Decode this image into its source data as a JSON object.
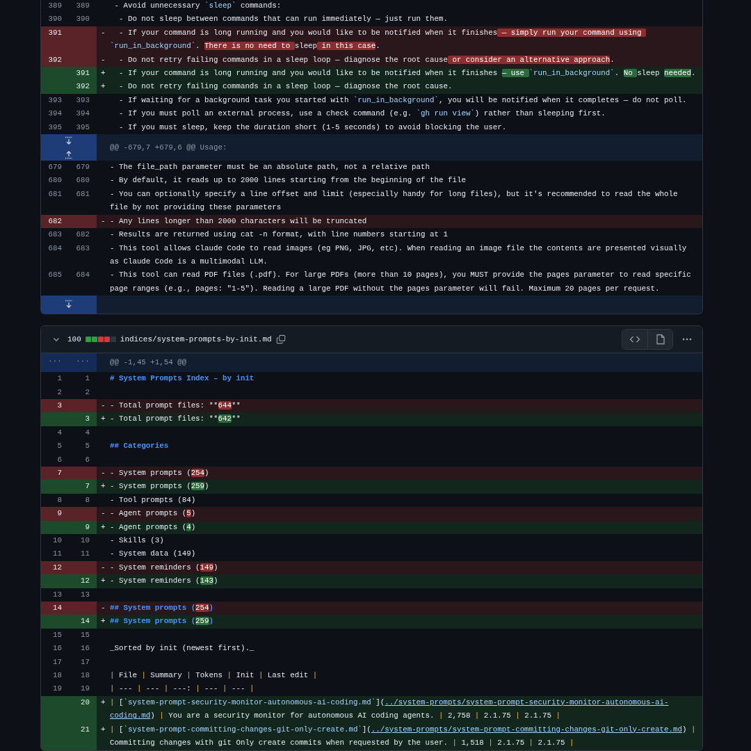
{
  "files": [
    {
      "lines": [
        {
          "kind": "context",
          "old": "389",
          "new": "389",
          "text": [
            " - Avoid unnecessary ",
            {
              "kind": "code",
              "t": "`sleep`"
            },
            " commands:"
          ]
        },
        {
          "kind": "context",
          "old": "390",
          "new": "390",
          "text": [
            "  - Do not sleep between commands that can run immediately — just run them."
          ]
        },
        {
          "kind": "del",
          "old": "391",
          "marker": "-",
          "text": [
            "  - If your command is long running and you would like to be notified when it finishes",
            {
              "kind": "hl",
              "t": " — simply run your command using "
            },
            {
              "kind": "code",
              "t": "`run_in_background`"
            },
            ". ",
            {
              "kind": "hl",
              "t": "There is no need to "
            },
            "sleep",
            {
              "kind": "hl",
              "t": " in this case"
            },
            "."
          ]
        },
        {
          "kind": "del",
          "old": "392",
          "marker": "-",
          "text": [
            "  - Do not retry failing commands in a sleep loop — diagnose the root cause",
            {
              "kind": "hl",
              "t": " or consider an alternative approach"
            },
            "."
          ]
        },
        {
          "kind": "add",
          "new": "391",
          "marker": "+",
          "text": [
            "  - If your command is long running and you would like to be notified when it finishes ",
            {
              "kind": "hl",
              "t": "— use "
            },
            {
              "kind": "code",
              "t": "`run_in_background`"
            },
            ". ",
            {
              "kind": "hl",
              "t": "No "
            },
            "sleep ",
            {
              "kind": "hl",
              "t": "needed"
            },
            "."
          ]
        },
        {
          "kind": "add",
          "new": "392",
          "marker": "+",
          "text": [
            "  - Do not retry failing commands in a sleep loop — diagnose the root cause."
          ]
        },
        {
          "kind": "context",
          "old": "393",
          "new": "393",
          "text": [
            "  - If waiting for a background task you started with ",
            {
              "kind": "code",
              "t": "`run_in_background`"
            },
            ", you will be notified when it completes — do not poll."
          ]
        },
        {
          "kind": "context",
          "old": "394",
          "new": "394",
          "text": [
            "  - If you must poll an external process, use a check command (e.g. ",
            {
              "kind": "code",
              "t": "`gh run view`"
            },
            ") rather than sleeping first."
          ]
        },
        {
          "kind": "context",
          "old": "395",
          "new": "395",
          "text": [
            "  - If you must sleep, keep the duration short (1-5 seconds) to avoid blocking the user."
          ]
        },
        {
          "kind": "hunk",
          "expand": [
            {
              "kind": "down"
            },
            {
              "kind": "up"
            }
          ],
          "text": "@@ -679,7 +679,6 @@ Usage:"
        },
        {
          "kind": "context",
          "old": "679",
          "new": "679",
          "text": [
            "- The file_path parameter must be an absolute path, not a relative path"
          ]
        },
        {
          "kind": "context",
          "old": "680",
          "new": "680",
          "text": [
            "- By default, it reads up to 2000 lines starting from the beginning of the file"
          ]
        },
        {
          "kind": "context",
          "old": "681",
          "new": "681",
          "text": [
            "- You can optionally specify a line offset and limit (especially handy for long files), but it's recommended to read the whole file by not providing these parameters"
          ]
        },
        {
          "kind": "del",
          "old": "682",
          "marker": "-",
          "text": [
            "- Any lines longer than 2000 characters will be truncated"
          ]
        },
        {
          "kind": "context",
          "old": "683",
          "new": "682",
          "text": [
            "- Results are returned using cat -n format, with line numbers starting at 1"
          ]
        },
        {
          "kind": "context",
          "old": "684",
          "new": "683",
          "text": [
            "- This tool allows Claude Code to read images (eg PNG, JPG, etc). When reading an image file the contents are presented visually as Claude Code is a multimodal LLM."
          ]
        },
        {
          "kind": "context",
          "old": "685",
          "new": "684",
          "text": [
            "- This tool can read PDF files (.pdf). For large PDFs (more than 10 pages), you MUST provide the pages parameter to read specific page ranges (e.g., pages: \"1-5\"). Reading a large PDF without the pages parameter will fail. Maximum 20 pages per request."
          ]
        },
        {
          "kind": "hunk",
          "expand": [
            {
              "kind": "down"
            }
          ]
        }
      ]
    },
    {
      "header": {
        "count": "100",
        "diffstat": [
          {
            "kind": "add"
          },
          {
            "kind": "add"
          },
          {
            "kind": "del"
          },
          {
            "kind": "del"
          },
          {
            "kind": "neutral"
          }
        ],
        "path": "indices/system-prompts-by-init.md"
      },
      "lines": [
        {
          "kind": "hunk",
          "old": "...",
          "new": "...",
          "text": "@@ -1,45 +1,54 @@"
        },
        {
          "kind": "context",
          "old": "1",
          "new": "1",
          "text": [
            {
              "kind": "heading",
              "t": "# System Prompts Index – by init"
            }
          ]
        },
        {
          "kind": "context",
          "old": "2",
          "new": "2"
        },
        {
          "kind": "del",
          "old": "3",
          "marker": "-",
          "text": [
            "- Total prompt files: **",
            {
              "kind": "hl",
              "t": "644"
            },
            "**"
          ]
        },
        {
          "kind": "add",
          "new": "3",
          "marker": "+",
          "text": [
            "- Total prompt files: **",
            {
              "kind": "hl",
              "t": "642"
            },
            "**"
          ]
        },
        {
          "kind": "context",
          "old": "4",
          "new": "4"
        },
        {
          "kind": "context",
          "old": "5",
          "new": "5",
          "text": [
            {
              "kind": "heading",
              "t": "## Categories"
            }
          ]
        },
        {
          "kind": "context",
          "old": "6",
          "new": "6"
        },
        {
          "kind": "del",
          "old": "7",
          "marker": "-",
          "text": [
            "- System prompts (",
            {
              "kind": "hl",
              "t": "254"
            },
            ")"
          ]
        },
        {
          "kind": "add",
          "new": "7",
          "marker": "+",
          "text": [
            "- System prompts (",
            {
              "kind": "hl",
              "t": "259"
            },
            ")"
          ]
        },
        {
          "kind": "context",
          "old": "8",
          "new": "8",
          "text": [
            "- Tool prompts (84)"
          ]
        },
        {
          "kind": "del",
          "old": "9",
          "marker": "-",
          "text": [
            "- Agent prompts (",
            {
              "kind": "hl",
              "t": "5"
            },
            ")"
          ]
        },
        {
          "kind": "add",
          "new": "9",
          "marker": "+",
          "text": [
            "- Agent prompts (",
            {
              "kind": "hl",
              "t": "4"
            },
            ")"
          ]
        },
        {
          "kind": "context",
          "old": "10",
          "new": "10",
          "text": [
            "- Skills (3)"
          ]
        },
        {
          "kind": "context",
          "old": "11",
          "new": "11",
          "text": [
            "- System data (149)"
          ]
        },
        {
          "kind": "del",
          "old": "12",
          "marker": "-",
          "text": [
            "- System reminders (",
            {
              "kind": "hl",
              "t": "149"
            },
            ")"
          ]
        },
        {
          "kind": "add",
          "new": "12",
          "marker": "+",
          "text": [
            "- System reminders (",
            {
              "kind": "hl",
              "t": "143"
            },
            ")"
          ]
        },
        {
          "kind": "context",
          "old": "13",
          "new": "13"
        },
        {
          "kind": "del",
          "old": "14",
          "marker": "-",
          "text": [
            {
              "kind": "heading",
              "t": "## System prompts ("
            },
            {
              "kind": "hl",
              "t": "254"
            },
            {
              "kind": "heading",
              "t": ")"
            }
          ]
        },
        {
          "kind": "add",
          "new": "14",
          "marker": "+",
          "text": [
            {
              "kind": "heading",
              "t": "## System prompts ("
            },
            {
              "kind": "hl",
              "t": "259"
            },
            {
              "kind": "heading",
              "t": ")"
            }
          ]
        },
        {
          "kind": "context",
          "old": "15",
          "new": "15"
        },
        {
          "kind": "context",
          "old": "16",
          "new": "16",
          "text": [
            "_Sorted by init (newest first)._"
          ]
        },
        {
          "kind": "context",
          "old": "17",
          "new": "17"
        },
        {
          "kind": "context",
          "old": "18",
          "new": "18",
          "text": [
            {
              "kind": "pipe",
              "t": "|"
            },
            " File ",
            {
              "kind": "pipe",
              "t": "|"
            },
            " Summary ",
            {
              "kind": "pipe",
              "t": "|"
            },
            " Tokens ",
            {
              "kind": "pipe",
              "t": "|"
            },
            " Init ",
            {
              "kind": "pipe",
              "t": "|"
            },
            " Last edit ",
            {
              "kind": "pipe",
              "t": "|"
            }
          ]
        },
        {
          "kind": "context",
          "old": "19",
          "new": "19",
          "text": [
            {
              "kind": "pipe",
              "t": "|"
            },
            " --- ",
            {
              "kind": "pipe",
              "t": "|"
            },
            " --- ",
            {
              "kind": "pipe",
              "t": "|"
            },
            " ---: ",
            {
              "kind": "pipe",
              "t": "|"
            },
            " --- ",
            {
              "kind": "pipe",
              "t": "|"
            },
            " --- ",
            {
              "kind": "pipe",
              "t": "|"
            }
          ]
        },
        {
          "kind": "add",
          "new": "20",
          "marker": "+",
          "text": [
            {
              "kind": "pipe",
              "t": "|"
            },
            " [",
            {
              "kind": "code",
              "t": "`system-prompt-security-monitor-autonomous-ai-coding.md`"
            },
            "](",
            {
              "kind": "link",
              "t": "../system-prompts/system-prompt-security-monitor-autonomous-ai-coding.md"
            },
            ") ",
            {
              "kind": "pipe",
              "t": "|"
            },
            " You are a security monitor for autonomous AI coding agents. ",
            {
              "kind": "pipe",
              "t": "|"
            },
            " 2,758 ",
            {
              "kind": "pipe",
              "t": "|"
            },
            " 2.1.75 ",
            {
              "kind": "pipe",
              "t": "|"
            },
            " 2.1.75 ",
            {
              "kind": "pipe",
              "t": "|"
            }
          ]
        },
        {
          "kind": "add",
          "new": "21",
          "marker": "+",
          "text": [
            {
              "kind": "pipe",
              "t": "|"
            },
            " [",
            {
              "kind": "code",
              "t": "`system-prompt-committing-changes-git-only-create.md`"
            },
            "](",
            {
              "kind": "link",
              "t": "../system-prompts/system-prompt-committing-changes-git-only-create.md"
            },
            ") ",
            {
              "kind": "pipe",
              "t": "|"
            },
            " Committing changes with git Only create commits when requested by the user. ",
            {
              "kind": "pipe",
              "t": "|"
            },
            " 1,518 ",
            {
              "kind": "pipe",
              "t": "|"
            },
            " 2.1.75 ",
            {
              "kind": "pipe",
              "t": "|"
            },
            " 2.1.75 ",
            {
              "kind": "pipe",
              "t": "|"
            }
          ]
        }
      ]
    }
  ]
}
